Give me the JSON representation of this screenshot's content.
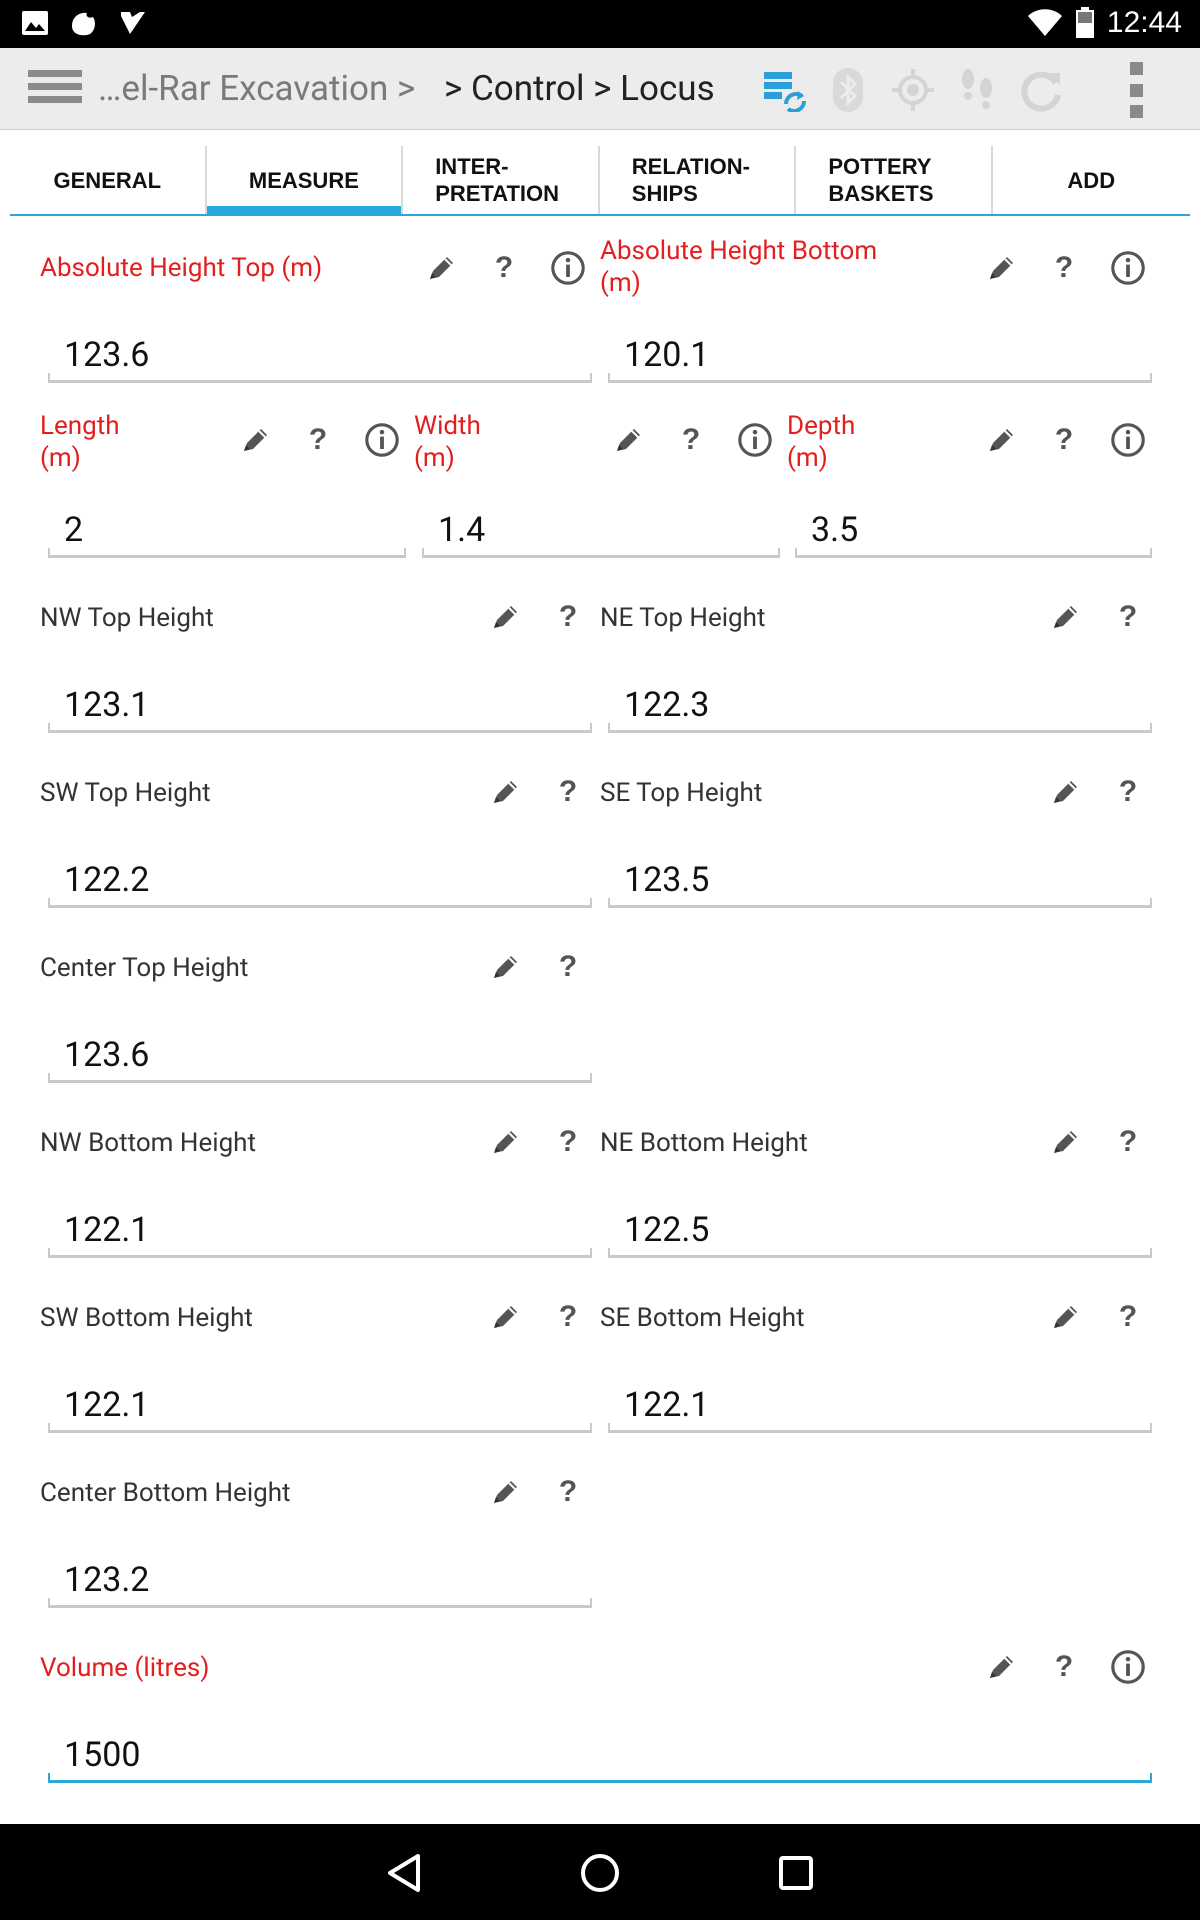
{
  "status_bar": {
    "time": "12:44"
  },
  "action_bar": {
    "breadcrumb_prefix": "…el-Rar Excavation >",
    "breadcrumb_current": "> Control > Locus"
  },
  "tabs": [
    {
      "label": "GENERAL",
      "active": false
    },
    {
      "label": "MEASURE",
      "active": true
    },
    {
      "label": "INTER-\nPRETATION",
      "active": false
    },
    {
      "label": "RELATION-\nSHIPS",
      "active": false
    },
    {
      "label": "POTTERY\nBASKETS",
      "active": false
    },
    {
      "label": "ADD",
      "active": false
    }
  ],
  "fields": {
    "abs_top": {
      "label": "Absolute Height Top (m)",
      "value": "123.6"
    },
    "abs_bottom": {
      "label": "Absolute Height Bottom\n(m)",
      "value": "120.1"
    },
    "length": {
      "label": "Length\n(m)",
      "value": "2"
    },
    "width": {
      "label": "Width\n(m)",
      "value": "1.4"
    },
    "depth": {
      "label": "Depth\n(m)",
      "value": "3.5"
    },
    "nw_top": {
      "label": "NW Top Height",
      "value": "123.1"
    },
    "ne_top": {
      "label": "NE Top Height",
      "value": "122.3"
    },
    "sw_top": {
      "label": "SW Top Height",
      "value": "122.2"
    },
    "se_top": {
      "label": "SE Top Height",
      "value": "123.5"
    },
    "center_top": {
      "label": "Center Top Height",
      "value": "123.6"
    },
    "nw_bottom": {
      "label": "NW Bottom Height",
      "value": "122.1"
    },
    "ne_bottom": {
      "label": "NE Bottom Height",
      "value": "122.5"
    },
    "sw_bottom": {
      "label": "SW Bottom Height",
      "value": "122.1"
    },
    "se_bottom": {
      "label": "SE Bottom Height",
      "value": "122.1"
    },
    "center_bottom": {
      "label": "Center Bottom Height",
      "value": "123.2"
    },
    "volume": {
      "label": "Volume (litres)",
      "value": "1500"
    }
  },
  "icons": {
    "help": "?"
  },
  "colors": {
    "required_label": "#e31e1e",
    "accent": "#2aa7d6",
    "status_bar": "#000000",
    "action_bar": "#ececec"
  }
}
